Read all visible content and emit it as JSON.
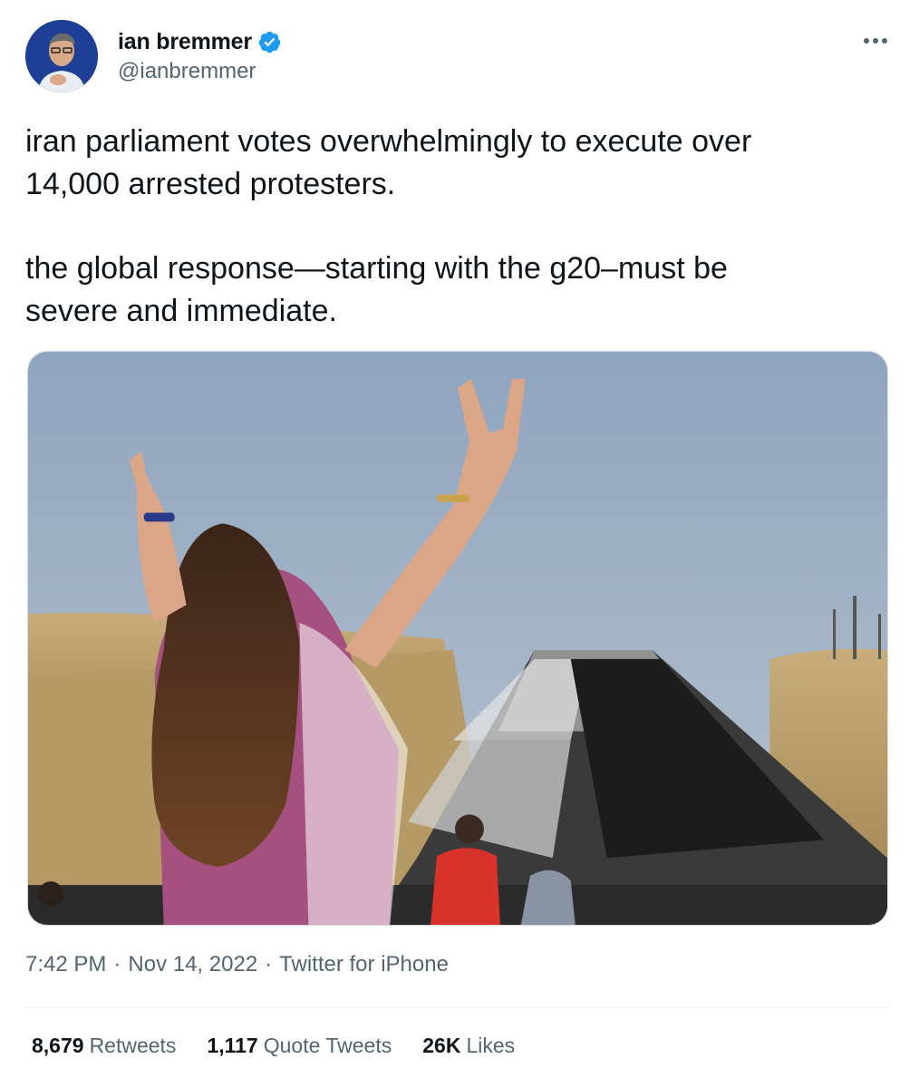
{
  "author": {
    "name": "ian bremmer",
    "handle": "@ianbremmer",
    "verified": true,
    "avatar_icon": "profile-photo-avatar",
    "verified_icon": "verified-badge-icon",
    "verified_color": "#1d9bf0"
  },
  "menu_icon": "more-options-icon",
  "tweet": {
    "text_paragraphs": [
      "iran parliament votes overwhelmingly to execute over\n14,000 arrested protesters.",
      "the global response—starting with the g20–must be\nsevere and immediate."
    ],
    "media_icon": "tweet-photo"
  },
  "meta": {
    "time": "7:42 PM",
    "separator": "·",
    "date": "Nov 14, 2022",
    "source": "Twitter for iPhone"
  },
  "stats": {
    "retweets_count": "8,679",
    "retweets_label": "Retweets",
    "quotes_count": "1,117",
    "quotes_label": "Quote Tweets",
    "likes_count": "26K",
    "likes_label": "Likes"
  },
  "colors": {
    "text_primary": "#0f1419",
    "text_secondary": "#536471",
    "divider": "#eff3f4",
    "accent": "#1d9bf0"
  }
}
